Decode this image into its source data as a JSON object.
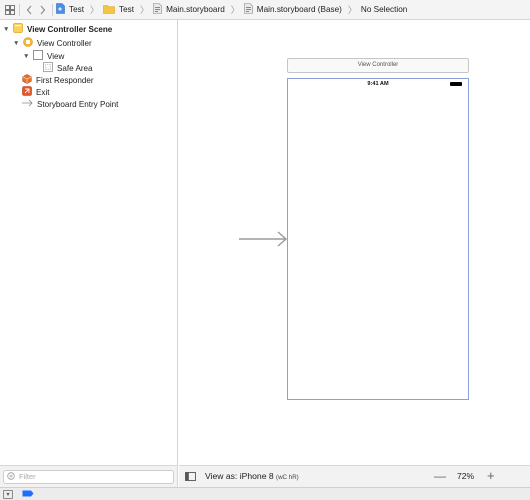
{
  "jumpbar": {
    "crumbs": [
      {
        "label": "Test",
        "icon": "project-icon"
      },
      {
        "label": "Test",
        "icon": "folder-icon"
      },
      {
        "label": "Main.storyboard",
        "icon": "storyboard-icon"
      },
      {
        "label": "Main.storyboard (Base)",
        "icon": "storyboard-icon"
      },
      {
        "label": "No Selection",
        "icon": ""
      }
    ]
  },
  "outline": {
    "items": [
      {
        "label": "View Controller Scene",
        "icon": "scene-icon",
        "bold": true
      },
      {
        "label": "View Controller",
        "icon": "view-controller-icon"
      },
      {
        "label": "View",
        "icon": "view-icon"
      },
      {
        "label": "Safe Area",
        "icon": "safe-area-icon"
      },
      {
        "label": "First Responder",
        "icon": "first-responder-icon"
      },
      {
        "label": "Exit",
        "icon": "exit-icon"
      },
      {
        "label": "Storyboard Entry Point",
        "icon": "entry-arrow-icon"
      }
    ]
  },
  "canvas": {
    "scene_title": "View Controller",
    "status_time": "9:41 AM"
  },
  "filter": {
    "placeholder": "Filter"
  },
  "bottom_bar": {
    "view_as": "View as: iPhone 8",
    "traits": "(wC hR)",
    "zoom": "72%",
    "zoom_out_label": "—",
    "zoom_in_label": "+"
  },
  "colors": {
    "device_border": "#8f9fd8",
    "accent": "#1e6fff"
  }
}
